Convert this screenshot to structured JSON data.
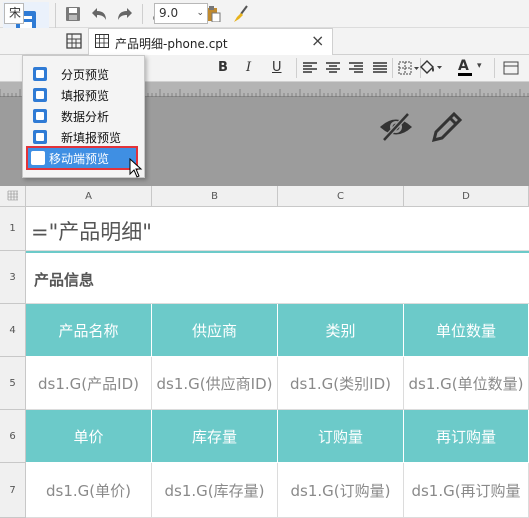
{
  "menu": {
    "items": [
      {
        "label": "分页预览"
      },
      {
        "label": "填报预览"
      },
      {
        "label": "数据分析"
      },
      {
        "label": "新填报预览"
      },
      {
        "label": "移动端预览"
      }
    ]
  },
  "tab": {
    "file_name": "产品明细-phone.cpt",
    "close_glyph": "×"
  },
  "format": {
    "font": "宋",
    "font_size": "9.0",
    "bold": "B",
    "italic": "I",
    "underline": "U",
    "font_color": "A"
  },
  "sheet": {
    "columns": [
      "A",
      "B",
      "C",
      "D"
    ],
    "rows": [
      {
        "num": "1",
        "cells": [
          "=\"产品明细\""
        ]
      },
      {
        "num": "3",
        "cells": [
          "产品信息"
        ]
      },
      {
        "num": "4",
        "cells": [
          "产品名称",
          "供应商",
          "类别",
          "单位数量"
        ]
      },
      {
        "num": "5",
        "cells": [
          "ds1.G(产品ID)",
          "ds1.G(供应商ID)",
          "ds1.G(类别ID)",
          "ds1.G(单位数量)"
        ]
      },
      {
        "num": "6",
        "cells": [
          "单价",
          "库存量",
          "订购量",
          "再订购量"
        ]
      },
      {
        "num": "7",
        "cells": [
          "ds1.G(单价)",
          "ds1.G(库存量)",
          "ds1.G(订购量)",
          "ds1.G(再订购量"
        ]
      }
    ]
  },
  "colors": {
    "accent": "#6ccac9",
    "selection": "#3f8fe3",
    "highlight_border": "#e2333a"
  }
}
